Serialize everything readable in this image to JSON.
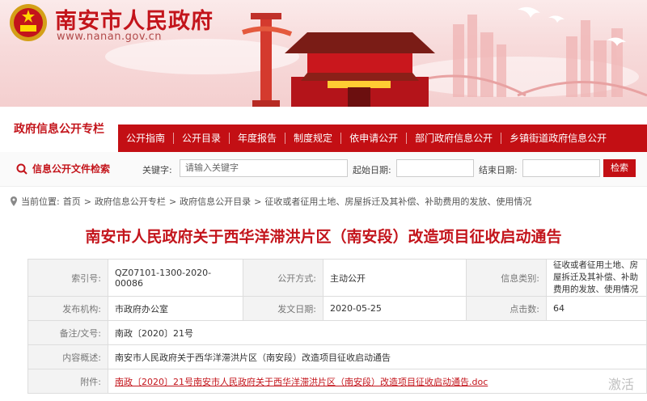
{
  "site": {
    "title": "南安市人民政府",
    "url": "www.nanan.gov.cn"
  },
  "nav": {
    "heading": "政府信息公开专栏",
    "items": [
      "公开指南",
      "公开目录",
      "年度报告",
      "制度规定",
      "依申请公开",
      "部门政府信息公开",
      "乡镇街道政府信息公开"
    ]
  },
  "search": {
    "title": "信息公开文件检索",
    "keyword_label": "关键字:",
    "keyword_placeholder": "请输入关键字",
    "start_label": "起始日期:",
    "end_label": "结束日期:",
    "button": "检索"
  },
  "breadcrumb": {
    "prefix": "当前位置:",
    "items": [
      "首页",
      "政府信息公开专栏",
      "政府信息公开目录",
      "征收或者征用土地、房屋拆迁及其补偿、补助费用的发放、使用情况"
    ]
  },
  "article": {
    "title": "南安市人民政府关于西华洋滞洪片区（南安段）改造项目征收启动通告"
  },
  "meta": {
    "index_no_label": "索引号:",
    "index_no": "QZ07101-1300-2020-00086",
    "open_mode_label": "公开方式:",
    "open_mode": "主动公开",
    "category_label": "信息类别:",
    "category": "征收或者征用土地、房屋拆迁及其补偿、补助费用的发放、使用情况",
    "issuer_label": "发布机构:",
    "issuer": "市政府办公室",
    "date_label": "发文日期:",
    "date": "2020-05-25",
    "clicks_label": "点击数:",
    "clicks": "64",
    "doc_no_label": "备注/文号:",
    "doc_no": "南政〔2020〕21号",
    "summary_label": "内容概述:",
    "summary": "南安市人民政府关于西华洋滞洪片区（南安段）改造项目征收启动通告",
    "attach_label": "附件:",
    "attach": "南政〔2020〕21号南安市人民政府关于西华洋滞洪片区（南安段）改造项目征收启动通告.doc"
  },
  "watermark": "激活"
}
